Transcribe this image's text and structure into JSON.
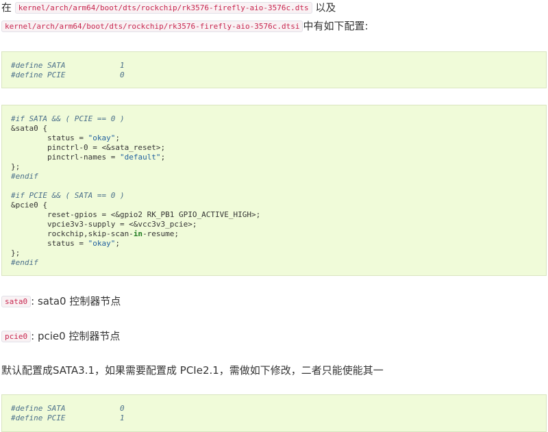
{
  "intro": {
    "prefix": "在",
    "file1": "kernel/arch/arm64/boot/dts/rockchip/rk3576-firefly-aio-3576c.dts",
    "and": "以及",
    "file2": "kernel/arch/arm64/boot/dts/rockchip/rk3576-firefly-aio-3576c.dtsi",
    "suffix": "中有如下配置:"
  },
  "block1": {
    "lines": [
      "#define SATA            1",
      "#define PCIE            0"
    ]
  },
  "block2": {
    "if_sata": "#if SATA && ( PCIE == 0 )",
    "sata_open": "&sata0 {",
    "sata_status_pre": "        status = ",
    "sata_status_val": "\"okay\"",
    "sata_status_post": ";",
    "sata_pinctrl0": "        pinctrl-0 = <&sata_reset>;",
    "sata_pinctrl_names_pre": "        pinctrl-names = ",
    "sata_pinctrl_names_val": "\"default\"",
    "sata_pinctrl_names_post": ";",
    "close1": "};",
    "endif1": "#endif",
    "if_pcie": "#if PCIE && ( SATA == 0 )",
    "pcie_open": "&pcie0 {",
    "reset_gpios": "        reset-gpios = <&gpio2 RK_PB1 GPIO_ACTIVE_HIGH>;",
    "vpcie": "        vpcie3v3-supply = <&vcc3v3_pcie>;",
    "skip_pre": "        rockchip,skip-scan-",
    "skip_kw": "in",
    "skip_post": "-resume;",
    "pcie_status_pre": "        status = ",
    "pcie_status_val": "\"okay\"",
    "pcie_status_post": ";",
    "close2": "};",
    "endif2": "#endif"
  },
  "sata_note": {
    "code": "sata0",
    "text": ": sata0 控制器节点"
  },
  "pcie_note": {
    "code": "pcie0",
    "text": ": pcie0 控制器节点"
  },
  "default_note": "默认配置成SATA3.1，如果需要配置成 PCIe2.1，需做如下修改，二者只能使能其一",
  "block3": {
    "lines": [
      "#define SATA            0",
      "#define PCIE            1"
    ]
  }
}
